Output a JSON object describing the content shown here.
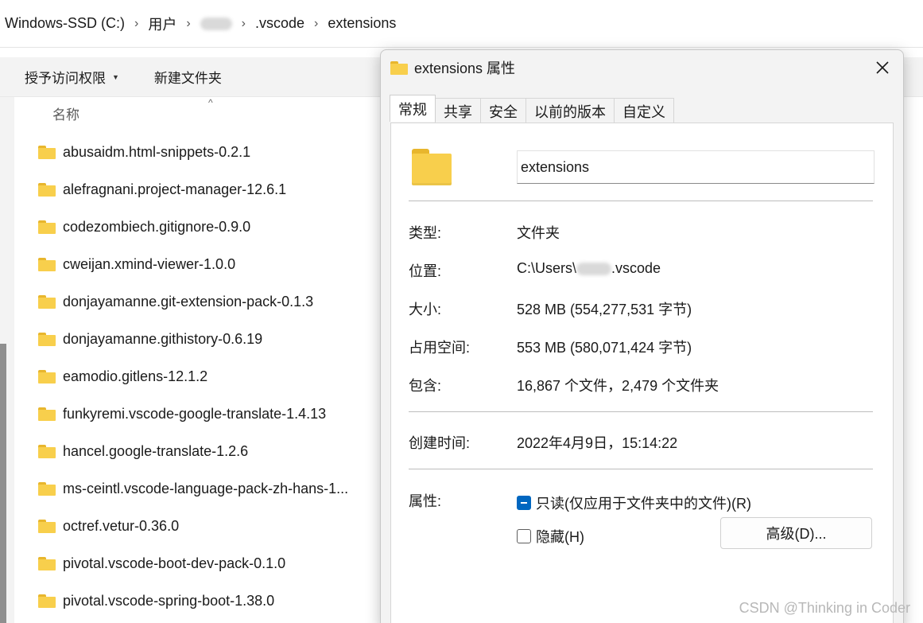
{
  "breadcrumb": {
    "items": [
      "Windows-SSD (C:)",
      "用户",
      ".vscode",
      "extensions"
    ],
    "separator": "›"
  },
  "toolbar": {
    "access_label": "授予访问权限",
    "new_folder_label": "新建文件夹"
  },
  "file_list": {
    "column_name": "名称",
    "items": [
      "abusaidm.html-snippets-0.2.1",
      "alefragnani.project-manager-12.6.1",
      "codezombiech.gitignore-0.9.0",
      "cweijan.xmind-viewer-1.0.0",
      "donjayamanne.git-extension-pack-0.1.3",
      "donjayamanne.githistory-0.6.19",
      "eamodio.gitlens-12.1.2",
      "funkyremi.vscode-google-translate-1.4.13",
      "hancel.google-translate-1.2.6",
      "ms-ceintl.vscode-language-pack-zh-hans-1...",
      "octref.vetur-0.36.0",
      "pivotal.vscode-boot-dev-pack-0.1.0",
      "pivotal.vscode-spring-boot-1.38.0"
    ]
  },
  "dialog": {
    "title": "extensions 属性",
    "tabs": [
      "常规",
      "共享",
      "安全",
      "以前的版本",
      "自定义"
    ],
    "name_value": "extensions",
    "type_label": "类型:",
    "type_value": "文件夹",
    "location_label": "位置:",
    "location_prefix": "C:\\Users\\",
    "location_suffix": ".vscode",
    "size_label": "大小:",
    "size_value": "528 MB (554,277,531 字节)",
    "disk_label": "占用空间:",
    "disk_value": "553 MB (580,071,424 字节)",
    "contains_label": "包含:",
    "contains_value": "16,867 个文件，2,479 个文件夹",
    "created_label": "创建时间:",
    "created_value": "2022年4月9日，15:14:22",
    "attributes_label": "属性:",
    "readonly_label": "只读(仅应用于文件夹中的文件)(R)",
    "hidden_label": "隐藏(H)",
    "advanced_label": "高级(D)..."
  },
  "watermark": "CSDN @Thinking in Coder",
  "colors": {
    "folder": "#f8cf4c",
    "accent": "#0067c0"
  }
}
